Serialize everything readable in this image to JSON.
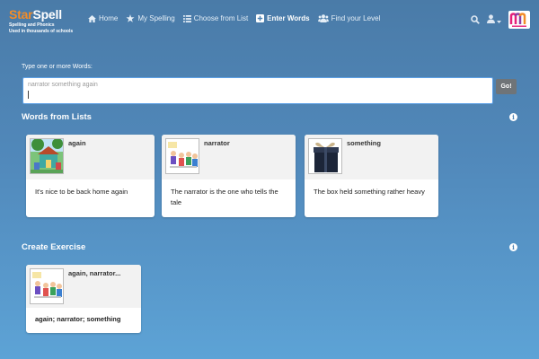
{
  "brand": {
    "star": "Star",
    "spell": "Spell",
    "tagline1": "Spelling and Phonics",
    "tagline2": "Used in thousands of schools"
  },
  "nav": [
    {
      "label": "Home",
      "icon": "home-icon"
    },
    {
      "label": "My Spelling",
      "icon": "star-icon"
    },
    {
      "label": "Choose from List",
      "icon": "list-icon"
    },
    {
      "label": "Enter Words",
      "icon": "plus-square-icon",
      "active": true
    },
    {
      "label": "Find your Level",
      "icon": "users-icon"
    }
  ],
  "input": {
    "label": "Type one or more Words:",
    "value": "narrator something again",
    "go": "Go!"
  },
  "words_section": {
    "title": "Words from Lists",
    "cards": [
      {
        "word": "again",
        "sentence": "It's nice to be back home again"
      },
      {
        "word": "narrator",
        "sentence": "The narrator is the one who tells the tale"
      },
      {
        "word": "something",
        "sentence": "The box held something rather heavy"
      }
    ]
  },
  "exercise_section": {
    "title": "Create Exercise",
    "card": {
      "title": "again, narrator...",
      "words": "again; narrator; something"
    }
  },
  "colors": {
    "accent_orange": "#f28c28",
    "background_top": "#4a7ba8",
    "background_bottom": "#5da3d6",
    "go_button": "#6f7478"
  }
}
